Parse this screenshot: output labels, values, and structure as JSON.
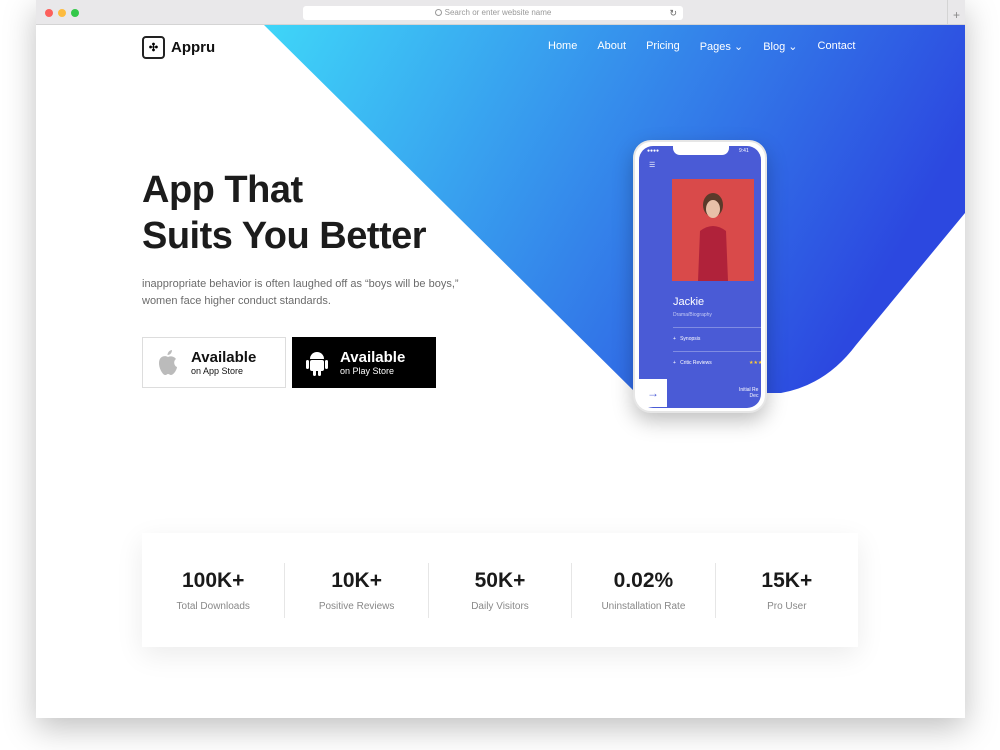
{
  "browser": {
    "url_placeholder": "Search or enter website name",
    "new_tab": "+"
  },
  "brand": {
    "name": "Appru"
  },
  "nav": [
    "Home",
    "About",
    "Pricing",
    "Pages",
    "Blog",
    "Contact"
  ],
  "hero": {
    "title_line1": "App That",
    "title_line2": "Suits You Better",
    "description": "inappropriate behavior is often laughed off as “boys will be boys,” women face higher conduct standards."
  },
  "buttons": {
    "app_store": {
      "title": "Available",
      "subtitle": "on App Store"
    },
    "play_store": {
      "title": "Available",
      "subtitle": "on Play Store"
    }
  },
  "phone": {
    "time": "9:41",
    "movie_title": "Jackie",
    "genre": "Drama/Biography",
    "rows": [
      "Synopsis",
      "Critic Reviews"
    ],
    "corner_line1": "Initial Re",
    "corner_line2": "Dec"
  },
  "stats": [
    {
      "value": "100K+",
      "label": "Total Downloads"
    },
    {
      "value": "10K+",
      "label": "Positive Reviews"
    },
    {
      "value": "50K+",
      "label": "Daily Visitors"
    },
    {
      "value": "0.02%",
      "label": "Uninstallation Rate"
    },
    {
      "value": "15K+",
      "label": "Pro User"
    }
  ],
  "colors": {
    "gradient_start": "#3fd1f7",
    "gradient_end": "#2f4bdf",
    "dark": "#1c1c1c"
  }
}
